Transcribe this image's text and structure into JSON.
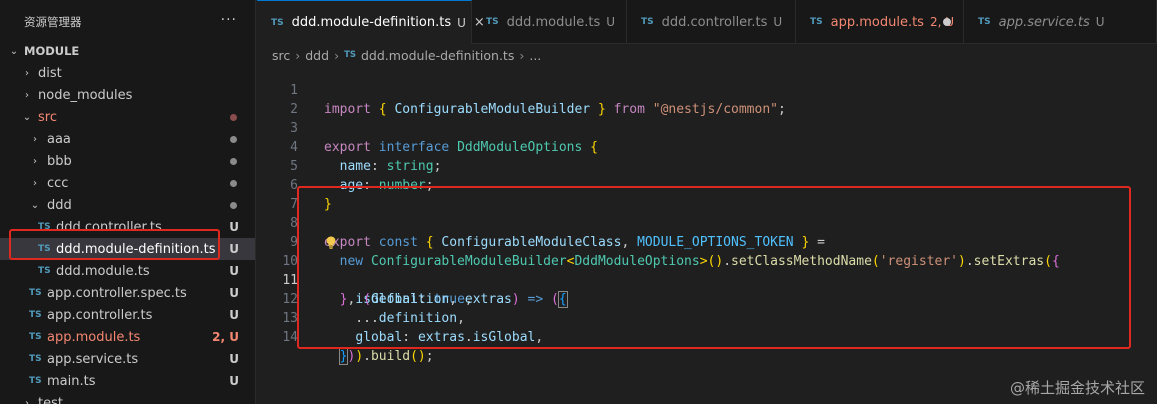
{
  "sidebar": {
    "title": "资源管理器",
    "more": "···",
    "root": "MODULE",
    "items": [
      {
        "label": "dist",
        "kind": "folder",
        "badge": ""
      },
      {
        "label": "node_modules",
        "kind": "folder",
        "badge": ""
      },
      {
        "label": "src",
        "kind": "folder-open",
        "badge": ""
      },
      {
        "label": "aaa",
        "kind": "folder",
        "badge": ""
      },
      {
        "label": "bbb",
        "kind": "folder",
        "badge": ""
      },
      {
        "label": "ccc",
        "kind": "folder",
        "badge": ""
      },
      {
        "label": "ddd",
        "kind": "folder-open",
        "badge": ""
      },
      {
        "label": "ddd.controller.ts",
        "kind": "file",
        "badge": "U"
      },
      {
        "label": "ddd.module-definition.ts",
        "kind": "file",
        "badge": "U"
      },
      {
        "label": "ddd.module.ts",
        "kind": "file",
        "badge": "U"
      },
      {
        "label": "app.controller.spec.ts",
        "kind": "file",
        "badge": "U"
      },
      {
        "label": "app.controller.ts",
        "kind": "file",
        "badge": "U"
      },
      {
        "label": "app.module.ts",
        "kind": "file",
        "badge": "2, U"
      },
      {
        "label": "app.service.ts",
        "kind": "file",
        "badge": "U"
      },
      {
        "label": "main.ts",
        "kind": "file",
        "badge": "U"
      },
      {
        "label": "test",
        "kind": "folder",
        "badge": ""
      }
    ],
    "ts_icon": "TS"
  },
  "tabs": [
    {
      "label": "ddd.module-definition.ts",
      "mark": "U",
      "close": "×"
    },
    {
      "label": "ddd.module.ts",
      "mark": "U"
    },
    {
      "label": "ddd.controller.ts",
      "mark": "U"
    },
    {
      "label": "app.module.ts",
      "mark": "2, U"
    },
    {
      "label": "app.service.ts",
      "mark": "U"
    }
  ],
  "breadcrumb": {
    "parts": [
      "src",
      "ddd",
      "ddd.module-definition.ts",
      "..."
    ],
    "sep": "›"
  },
  "editor": {
    "line_numbers": [
      "1",
      "2",
      "3",
      "4",
      "5",
      "6",
      "7",
      "8",
      "9",
      "10",
      "11",
      "12",
      "13",
      "14"
    ],
    "lines": [
      "import { ConfigurableModuleBuilder } from \"@nestjs/common\";",
      "",
      "export interface DddModuleOptions {",
      "  name: string;",
      "  age: number;",
      "}",
      "",
      "export const { ConfigurableModuleClass, MODULE_OPTIONS_TOKEN } =",
      "  new ConfigurableModuleBuilder<DddModuleOptions>().setClassMethodName('register').setExtras({",
      "    isGlobal: true,",
      "  }, (definition, extras) => ({",
      "    ...definition,",
      "    global: extras.isGlobal,",
      "  })).build();"
    ],
    "current_line": "11"
  },
  "watermark": "@稀土掘金技术社区",
  "colors": {
    "accent": "#0078d4",
    "annotation": "#e0281f",
    "modified_error": "#f48771"
  }
}
